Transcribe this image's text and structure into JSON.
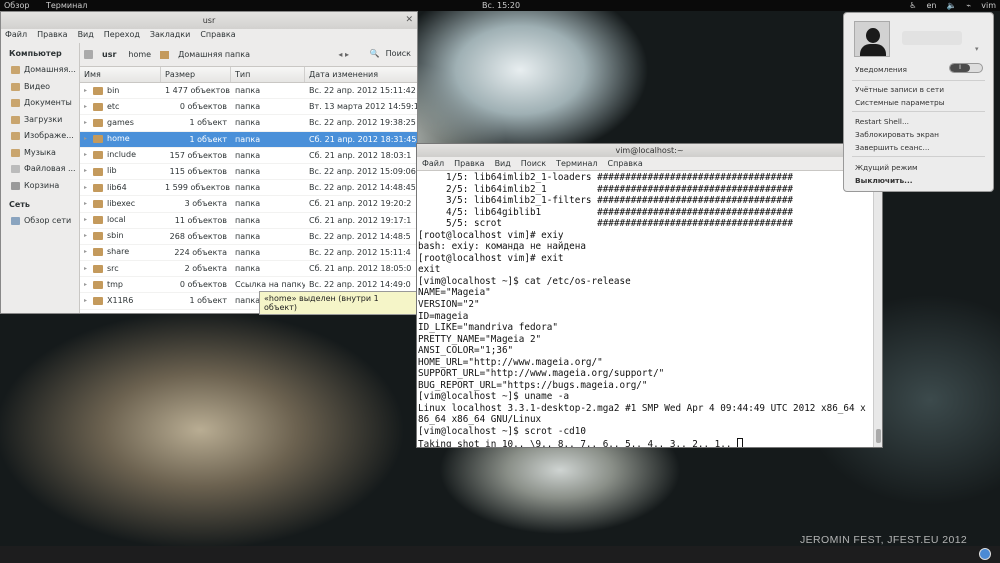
{
  "topbar": {
    "activities": "Обзор",
    "app_menu": "Терминал",
    "clock": "Вс. 15:20",
    "tray": [
      "en",
      "vim"
    ]
  },
  "file_manager": {
    "title": "usr",
    "menu": [
      "Файл",
      "Правка",
      "Вид",
      "Переход",
      "Закладки",
      "Справка"
    ],
    "sidebar": {
      "heading_computer": "Компьютер",
      "items": [
        "Домашняя...",
        "Видео",
        "Документы",
        "Загрузки",
        "Изображе...",
        "Музыка",
        "Файловая ...",
        "Корзина"
      ],
      "heading_network": "Сеть",
      "network_items": [
        "Обзор сети"
      ]
    },
    "path": [
      "usr",
      "home",
      "Домашняя папка"
    ],
    "search_label": "Поиск",
    "columns": [
      "Имя",
      "Размер",
      "Тип",
      "Дата изменения"
    ],
    "rows": [
      {
        "name": "bin",
        "size": "1 477 объектов",
        "type": "папка",
        "date": "Вс. 22 апр. 2012 15:11:42"
      },
      {
        "name": "etc",
        "size": "0 объектов",
        "type": "папка",
        "date": "Вт. 13 марта 2012 14:59:1"
      },
      {
        "name": "games",
        "size": "1 объект",
        "type": "папка",
        "date": "Вс. 22 апр. 2012 19:38:25"
      },
      {
        "name": "home",
        "size": "1 объект",
        "type": "папка",
        "date": "Сб. 21 апр. 2012 18:31:45",
        "selected": true
      },
      {
        "name": "include",
        "size": "157 объектов",
        "type": "папка",
        "date": "Сб. 21 апр. 2012 18:03:1"
      },
      {
        "name": "lib",
        "size": "115 объектов",
        "type": "папка",
        "date": "Вс. 22 апр. 2012 15:09:06"
      },
      {
        "name": "lib64",
        "size": "1 599 объектов",
        "type": "папка",
        "date": "Вс. 22 апр. 2012 14:48:45"
      },
      {
        "name": "libexec",
        "size": "3 объекта",
        "type": "папка",
        "date": "Сб. 21 апр. 2012 19:20:2"
      },
      {
        "name": "local",
        "size": "11 объектов",
        "type": "папка",
        "date": "Сб. 21 апр. 2012 19:17:1"
      },
      {
        "name": "sbin",
        "size": "268 объектов",
        "type": "папка",
        "date": "Вс. 22 апр. 2012 14:48:5"
      },
      {
        "name": "share",
        "size": "224 объекта",
        "type": "папка",
        "date": "Вс. 22 апр. 2012 15:11:4"
      },
      {
        "name": "src",
        "size": "2 объекта",
        "type": "папка",
        "date": "Сб. 21 апр. 2012 18:05:0"
      },
      {
        "name": "tmp",
        "size": "0 объектов",
        "type": "Ссылка на папку",
        "date": "Вс. 22 апр. 2012 14:49:0"
      },
      {
        "name": "X11R6",
        "size": "1 объект",
        "type": "папка",
        "date": ""
      }
    ],
    "status_tooltip": "«home» выделен (внутри 1 объект)"
  },
  "terminal": {
    "title": "vim@localhost:~",
    "menu": [
      "Файл",
      "Правка",
      "Вид",
      "Поиск",
      "Терминал",
      "Справка"
    ],
    "lines": [
      "     1/5: lib64imlib2_1-loaders ###################################",
      "     2/5: lib64imlib2_1         ###################################",
      "     3/5: lib64imlib2_1-filters ###################################",
      "     4/5: lib64giblib1          ###################################",
      "     5/5: scrot                 ###################################",
      "[root@localhost vim]# exiy",
      "bash: exiy: команда не найдена",
      "[root@localhost vim]# exit",
      "exit",
      "[vim@localhost ~]$ cat /etc/os-release",
      "NAME=\"Mageia\"",
      "VERSION=\"2\"",
      "ID=mageia",
      "ID_LIKE=\"mandriva fedora\"",
      "PRETTY_NAME=\"Mageia 2\"",
      "ANSI_COLOR=\"1;36\"",
      "HOME_URL=\"http://www.mageia.org/\"",
      "SUPPORT_URL=\"http://www.mageia.org/support/\"",
      "BUG_REPORT_URL=\"https://bugs.mageia.org/\"",
      "[vim@localhost ~]$ uname -a",
      "Linux localhost 3.3.1-desktop-2.mga2 #1 SMP Wed Apr 4 09:44:49 UTC 2012 x86_64 x",
      "86_64 x86_64 GNU/Linux",
      "[vim@localhost ~]$ scrot -cd10",
      "Taking shot in 10.. \\9.. 8.. 7.. 6.. 5.. 4.. 3.. 2.. 1.. "
    ]
  },
  "user_menu": {
    "notifications": "Уведомления",
    "toggle_label": "I",
    "items": [
      "Учётные записи в сети",
      "Системные параметры",
      "Restart Shell...",
      "Заблокировать экран",
      "Завершить сеанс...",
      "Ждущий режим",
      "Выключить..."
    ]
  },
  "watermark": "JEROMIN FEST, JFEST.EU 2012"
}
